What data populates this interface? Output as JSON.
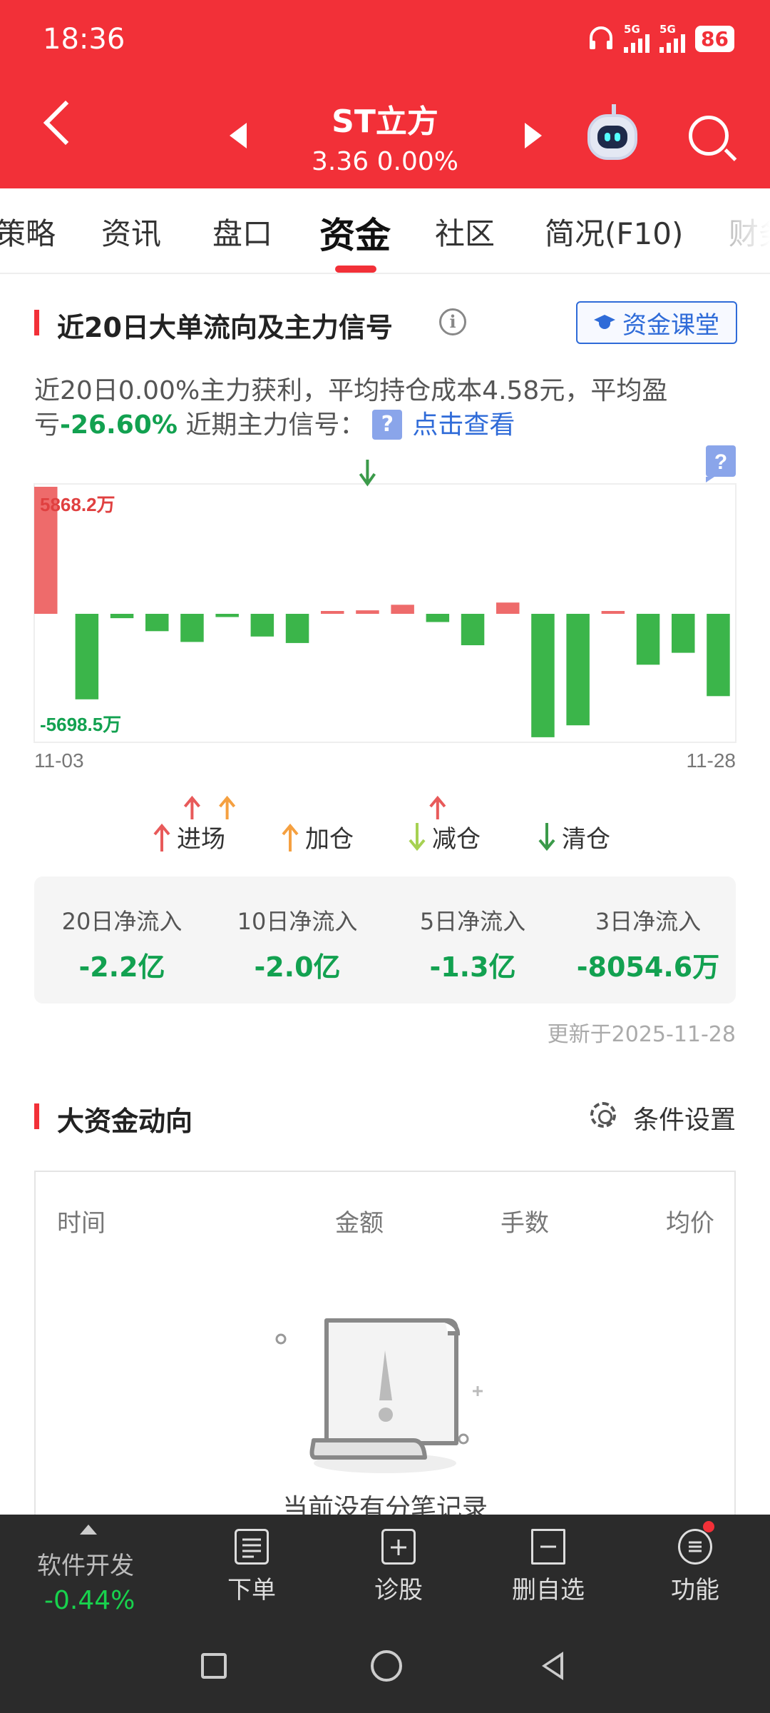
{
  "status_bar": {
    "time": "18:36",
    "network1": "5G",
    "network2": "5G",
    "battery": "86"
  },
  "header": {
    "stock_name": "ST立方",
    "price_line": "3.36 0.00%"
  },
  "tabs": [
    {
      "label": "策略"
    },
    {
      "label": "资讯"
    },
    {
      "label": "盘口"
    },
    {
      "label": "资金",
      "active": true
    },
    {
      "label": "社区"
    },
    {
      "label": "简况(F10)"
    },
    {
      "label": "财务"
    }
  ],
  "flow_section": {
    "title": "近20日大单流向及主力信号",
    "class_button": "资金课堂",
    "desc_part1": "近20日0.00%主力获利，平均持仓成本4.58元，平均盈亏",
    "desc_percent": "-26.60%",
    "desc_part2": "近期主力信号：",
    "desc_link": "点击查看",
    "help_badge": "?"
  },
  "chart_data": {
    "type": "bar",
    "title": "",
    "x_start": "11-03",
    "x_end": "11-28",
    "max_label": "5868.2万",
    "min_label": "-5698.5万",
    "unit": "万",
    "values": [
      5868.2,
      -3950,
      -200,
      -800,
      -1300,
      -150,
      -1050,
      -1350,
      120,
      160,
      420,
      -380,
      -1450,
      520,
      -5698.5,
      -5150,
      100,
      -2350,
      -1800,
      -3800
    ],
    "colors": {
      "positive": "#ee6b6b",
      "negative": "#3bb54a",
      "sell_signal": "#3b9a4a",
      "enter": "#e85a5a",
      "add": "#f5a040"
    },
    "signals": [
      {
        "index": 4,
        "type": "enter"
      },
      {
        "index": 5,
        "type": "add"
      },
      {
        "index": 11,
        "type": "enter"
      },
      {
        "index": 9,
        "type": "clear",
        "position": "top"
      }
    ],
    "legend": [
      "进场",
      "加仓",
      "减仓",
      "清仓"
    ]
  },
  "summary": {
    "items": [
      {
        "label": "20日净流入",
        "value": "-2.2亿"
      },
      {
        "label": "10日净流入",
        "value": "-2.0亿"
      },
      {
        "label": "5日净流入",
        "value": "-1.3亿"
      },
      {
        "label": "3日净流入",
        "value": "-8054.6万"
      }
    ],
    "updated": "更新于2025-11-28"
  },
  "big_money": {
    "title": "大资金动向",
    "settings": "条件设置",
    "columns": [
      "时间",
      "金额",
      "手数",
      "均价"
    ],
    "empty": "当前没有分笔记录"
  },
  "bottom_bar": {
    "ticker_name": "软件开发",
    "ticker_value": "-0.44%",
    "order": "下单",
    "diagnose": "诊股",
    "remove_watch": "删自选",
    "functions": "功能"
  }
}
